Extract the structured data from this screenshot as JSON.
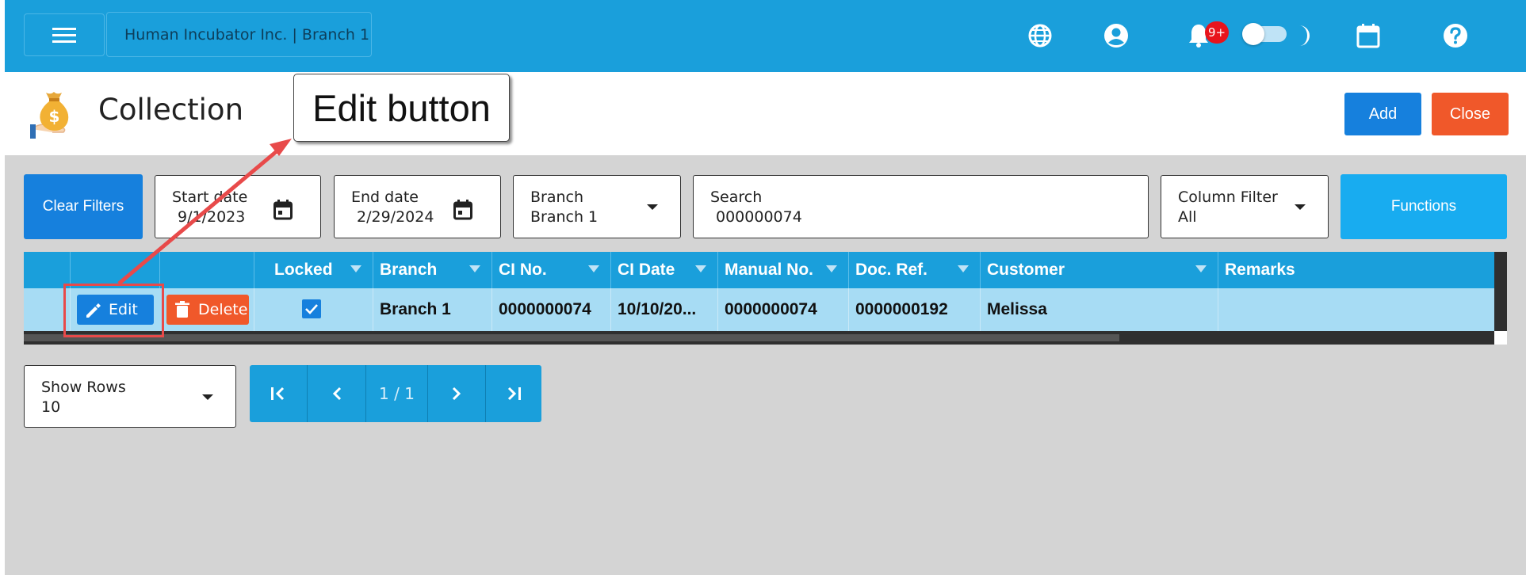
{
  "header": {
    "org": "Human Incubator Inc. | Branch 1",
    "notification_count": "9+",
    "icons": [
      "menu-icon",
      "globe-icon",
      "user-icon",
      "bell-icon",
      "theme-toggle",
      "moon-icon",
      "calendar-icon",
      "help-icon"
    ]
  },
  "page": {
    "title": "Collection",
    "add_label": "Add",
    "close_label": "Close"
  },
  "annotation": {
    "text": "Edit button"
  },
  "filters": {
    "clear_label": "Clear Filters",
    "start_date": {
      "label": "Start date",
      "value": "9/1/2023"
    },
    "end_date": {
      "label": "End date",
      "value": "2/29/2024"
    },
    "branch": {
      "label": "Branch",
      "value": "Branch 1"
    },
    "search": {
      "label": "Search",
      "value": "000000074"
    },
    "column_filter": {
      "label": "Column Filter",
      "value": "All"
    },
    "functions_label": "Functions"
  },
  "table": {
    "columns": [
      "Locked",
      "Branch",
      "CI No.",
      "CI Date",
      "Manual No.",
      "Doc. Ref.",
      "Customer",
      "Remarks"
    ],
    "rows": [
      {
        "edit_label": "Edit",
        "delete_label": "Delete",
        "locked": true,
        "branch": "Branch 1",
        "ci_no": "0000000074",
        "ci_date": "10/10/20...",
        "manual_no": "0000000074",
        "doc_ref": "0000000192",
        "customer": "Melissa",
        "remarks": ""
      }
    ]
  },
  "pagination": {
    "show_rows_label": "Show Rows",
    "show_rows_value": "10",
    "page_info": "1 / 1"
  },
  "colors": {
    "header_bg": "#1a9fdb",
    "primary": "#1680dd",
    "danger": "#f0582a",
    "row_selected": "#a7dcf4",
    "badge": "#e8141c"
  }
}
